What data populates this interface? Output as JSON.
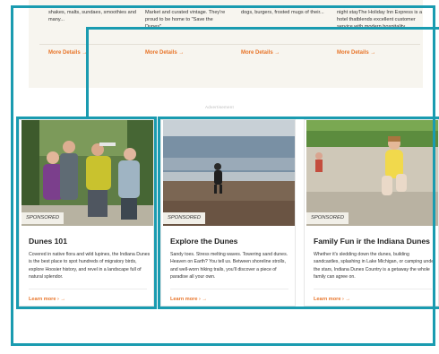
{
  "colors": {
    "frame": "#1a9bb0",
    "accent": "#e8752a"
  },
  "top_row": {
    "columns": [
      {
        "text": "shakes, malts, sundaes, smoothies and many...",
        "more": "More Details →"
      },
      {
        "text": "Market and curated vintage. They're proud to be home to \"Save the Dunes\"...",
        "more": "More Details →"
      },
      {
        "text": "dogs, burgers, frosted mugs of their...",
        "more": "More Details →"
      },
      {
        "text": "night stayThe Holiday Inn Express is a hotel thatblends excellent customer service with modern hospitality...",
        "more": "More Details →"
      }
    ]
  },
  "ad_label": "Advertisement",
  "cards": [
    {
      "badge": "SPONSORED",
      "title": "Dunes 101",
      "description": "Covered in native flora and wild lupines, the Indiana Dunes is the best place to spot hundreds of migratory birds, explore Hoosier history, and revel in a landscape full of natural splendor.",
      "link": "Learn more ›  →",
      "image_icon": "group-hikers-photo"
    },
    {
      "badge": "SPONSORED",
      "title": "Explore the Dunes",
      "description": "Sandy toes. Stress melting waves. Towering sand dunes. Heaven on Earth? You tell us. Between shoreline strolls, and well-worn hiking trails, you'll discover a piece of paradise all your own.",
      "link": "Learn more ›  →",
      "image_icon": "beach-child-photo"
    },
    {
      "badge": "SPONSORED",
      "title": "Family Fun ir the Indiana Dunes",
      "description": "Whether it's sledding down the dunes, building sandcastles, splashing in Lake Michigan, or camping under the stars, Indiana Dunes Country is a getaway the whole family can agree on.",
      "link": "Learn more ›  →",
      "image_icon": "dune-girl-photo"
    }
  ]
}
